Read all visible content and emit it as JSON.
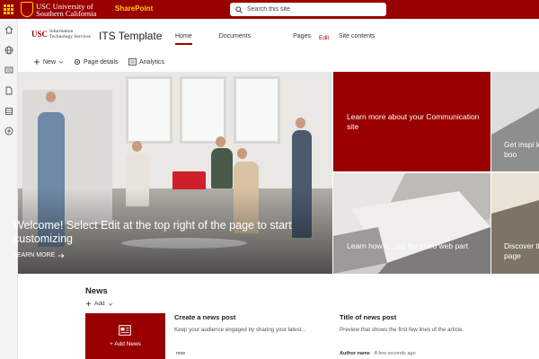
{
  "suite_bar": {
    "logo_line1": "USC University of",
    "logo_line2": "Southern California",
    "app_name": "SharePoint",
    "search_placeholder": "Search this site",
    "background_color": "#990000",
    "accent_color": "#ffcc00"
  },
  "app_bar": {
    "icons": [
      "home-icon",
      "globe-icon",
      "news-icon",
      "document-icon",
      "lists-icon",
      "add-icon"
    ]
  },
  "site_header": {
    "logo_mark": "USC",
    "logo_line1": "Information",
    "logo_line2": "Technology Services",
    "site_title": "ITS Template",
    "nav": [
      "Home",
      "Documents",
      "Pages",
      "Site contents"
    ],
    "edit_label": "Edit"
  },
  "command_bar": {
    "new_label": "New",
    "page_details_label": "Page details",
    "analytics_label": "Analytics"
  },
  "hero": {
    "main_title": "Welcome! Select Edit at the top right of the page to start customizing",
    "main_link": "LEARN MORE",
    "tile2_title": "Learn more about your Communication site",
    "tile3_title": "Learn how to use the Hero web part",
    "tile4_title": "Get inspi look boo",
    "tile5_title": "Discover this page",
    "tile_red_color": "#990000"
  },
  "news": {
    "heading": "News",
    "add_label": "Add",
    "add_news_label": "+ Add News",
    "items": [
      {
        "title": "Create a news post",
        "description": "Keep your audience engaged by sharing your latest...",
        "author": "now",
        "time": ""
      },
      {
        "title": "Title of news post",
        "description": "Preview that shows the first few lines of the article.",
        "author": "Author name",
        "time": "A few seconds ago"
      }
    ]
  }
}
